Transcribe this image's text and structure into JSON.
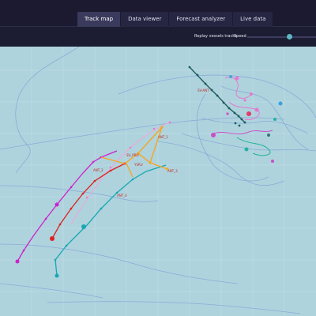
{
  "nav": {
    "tabs": [
      {
        "label": "Track map",
        "active": true
      },
      {
        "label": "Data viewer",
        "active": false
      },
      {
        "label": "Forecast analyzer",
        "active": false
      },
      {
        "label": "Live data",
        "active": false
      }
    ]
  },
  "controls": {
    "replay_label": "Replay vessels tracks",
    "speed_label": "Speed",
    "speed_level": 0.62
  },
  "map": {
    "background": "#aed3dd",
    "labels": {
      "sv_ant": "SV-ANT",
      "ant1": "ANT_1",
      "ant2": "ANT_2",
      "ant3": "ANT_3",
      "ant4": "ANT_4",
      "ysru": "YSRU",
      "sv_pro": "SV_PRO"
    },
    "track_colors": {
      "magenta": "#cc22cc",
      "red": "#dd2222",
      "teal": "#17a7b2",
      "orange": "#f5a623",
      "dark_teal": "#1e5b5e",
      "faint_blue": "#7f9fd6",
      "pink": "#e678d0"
    }
  }
}
